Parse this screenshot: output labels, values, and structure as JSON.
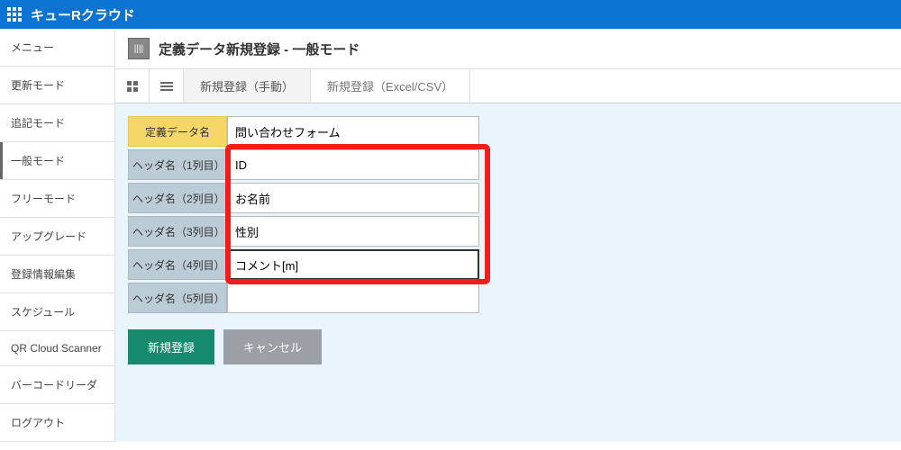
{
  "topbar": {
    "title": "キューRクラウド"
  },
  "sidebar": {
    "items": [
      {
        "label": "メニュー"
      },
      {
        "label": "更新モード"
      },
      {
        "label": "追記モード"
      },
      {
        "label": "一般モード"
      },
      {
        "label": "フリーモード"
      },
      {
        "label": "アップグレード"
      },
      {
        "label": "登録情報編集"
      },
      {
        "label": "スケジュール"
      },
      {
        "label": "QR Cloud Scanner"
      },
      {
        "label": "バーコードリーダ"
      },
      {
        "label": "ログアウト"
      }
    ],
    "active_index": 3
  },
  "page": {
    "title": "定義データ新規登録 - 一般モード"
  },
  "tabs": {
    "items": [
      {
        "label": "新規登録（手動）"
      },
      {
        "label": "新規登録（Excel/CSV）"
      }
    ],
    "active_index": 0
  },
  "form": {
    "name_label": "定義データ名",
    "name_value": "問い合わせフォーム",
    "rows": [
      {
        "label": "ヘッダ名（1列目）",
        "value": "ID"
      },
      {
        "label": "ヘッダ名（2列目）",
        "value": "お名前"
      },
      {
        "label": "ヘッダ名（3列目）",
        "value": "性別"
      },
      {
        "label": "ヘッダ名（4列目）",
        "value": "コメント[m]"
      },
      {
        "label": "ヘッダ名（5列目）",
        "value": ""
      }
    ]
  },
  "buttons": {
    "submit": "新規登録",
    "cancel": "キャンセル"
  }
}
